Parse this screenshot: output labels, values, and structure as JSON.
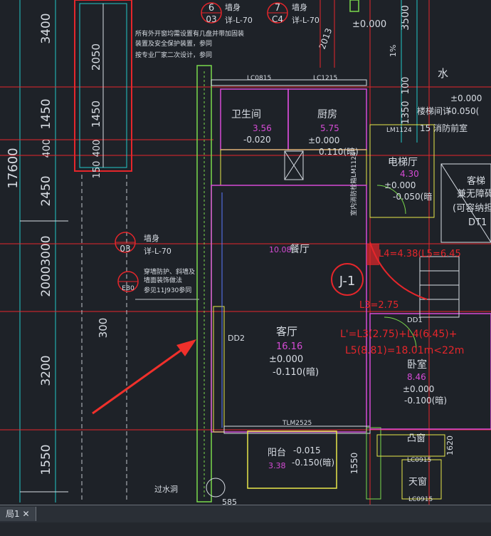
{
  "drawing": {
    "dim_17600": "17600",
    "dim_3400": "3400",
    "dim_1450": "1450",
    "dim_400": "400",
    "dim_2450": "2450",
    "dim_3000": "3000",
    "dim_2000": "2000",
    "dim_300": "300",
    "dim_3200": "3200",
    "dim_1550": "1550",
    "stair_dim_2050": "2050",
    "stair_dim_1450": "1450",
    "stair_dim_400": "400",
    "stair_dim_150": "150",
    "top_dim_3500": "3500",
    "top_dim_2013": "2013",
    "top_dim_1550_right": "1550",
    "top_level_0": "±0.000",
    "callout_6": "6",
    "callout_03a": "03",
    "callout_7": "7",
    "callout_c4": "C4",
    "callout_label_a": "墙身",
    "callout_ref_a": "详-L-70",
    "callout_label_b": "墙身",
    "callout_ref_b": "详-L-70",
    "note_line1": "所有外开窗均需设置有几盘并带加固装",
    "note_line2": "装置及安全保护装置，参同",
    "note_line3": "按专业厂家二次设计，参同",
    "callout_03b": "03",
    "callout_label_c": "墙身",
    "callout_ref_c": "详-L-70",
    "note2_line1": "穿墙防护、斜墙及",
    "note2_line2": "墙面装饰做法",
    "note2_line3": "参见11J930参同",
    "callout_f": "EB0",
    "toilet_name": "卫生间",
    "toilet_area": "3.56",
    "toilet_level": "-0.020",
    "win_lc0815": "LC0815",
    "win_lc1215": "LC1215",
    "kitchen_name": "厨房",
    "kitchen_area": "5.75",
    "kitchen_level": "±0.000",
    "kitchen_level2": "0.110(暗)",
    "right_1550": "100",
    "right_1350": "1350",
    "right_mark_1": "1%",
    "water_pipe": "水",
    "right_level_0": "±0.000",
    "right_level_1": "-0.050(",
    "door_lm1124": "LM1124",
    "corridor_text": "15 消防前室",
    "corridor_text2": "楼梯间详",
    "elevator_hall": "电梯厅",
    "elevator_area": "4.30",
    "elevator_level": "±0.000",
    "elevator_level2": "-0.050(暗",
    "stair_text1": "客梯",
    "stair_text2": "兼无障碍",
    "stair_text3": "(可容纳担",
    "stair_text4": "DT1",
    "vertical_note": "室内消防栓箱LM1124",
    "dining_area": "10.08",
    "dining_name": "餐厅",
    "section_mark": "J-1",
    "formula_1": "L4=4.38(L5=6.45",
    "formula_2": "L3=2.75",
    "door_dd1": "DD1",
    "formula_3": "L'=L3(2.75)+L4(6.45)+",
    "formula_4": "L5(8.81)=18.01m<22m",
    "living_name": "客厅",
    "living_area": "16.16",
    "living_level": "±0.000",
    "living_level2": "-0.110(暗)",
    "door_dd2": "DD2",
    "bedroom_name": "卧室",
    "bedroom_area": "8.46",
    "bedroom_level": "±0.000",
    "bedroom_level2": "-0.100(暗)",
    "win_tlm": "TLM2525",
    "bay_name": "凸窗",
    "bay_code": "LC0915",
    "balcony_name": "阳台",
    "balcony_level": "-0.015",
    "balcony_area": "3.38",
    "balcony_level2": "-0.150(暗)",
    "skywell_name": "天窗",
    "skywell_code": "LC0915",
    "drain_note": "过水洞",
    "dim_585": "585",
    "rt_1550": "1550",
    "rt_0": "100",
    "rt_1620": "1620"
  },
  "status": {
    "tab_label": "局1"
  }
}
